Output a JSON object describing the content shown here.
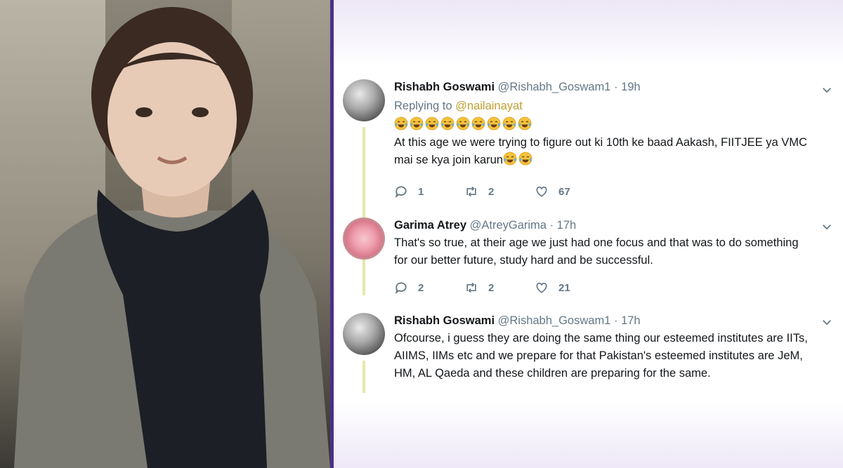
{
  "tweets": [
    {
      "name": "Rishabh Goswami",
      "handle": "@Rishabh_Goswam1",
      "separator": "·",
      "time": "19h",
      "replying_label": "Replying to",
      "replying_to": "@nailainayat",
      "emoji_line_count": 9,
      "text_line_1": "At this age we were trying to figure out ki 10th ke baad Aakash, FIITJEE ya VMC",
      "text_line_2": "mai se kya join karun",
      "text_line_2_emoji_count": 2,
      "replies": "1",
      "retweets": "2",
      "likes": "67"
    },
    {
      "name": "Garima Atrey",
      "handle": "@AtreyGarima",
      "separator": "·",
      "time": "17h",
      "text_line_1": "That's so true, at their age we just had one focus and that was to do something",
      "text_line_2": "for our better future, study hard and be successful.",
      "replies": "2",
      "retweets": "2",
      "likes": "21"
    },
    {
      "name": "Rishabh Goswami",
      "handle": "@Rishabh_Goswam1",
      "separator": "·",
      "time": "17h",
      "text_line_1": "Ofcourse, i guess they are doing the same thing our esteemed institutes are IITs,",
      "text_line_2": "AIIMS, IIMs etc and we prepare for that Pakistan's esteemed institutes are JeM,",
      "text_line_3": "HM, AL Qaeda and these children are preparing for the same."
    }
  ],
  "icons": {
    "reply": "reply-icon",
    "retweet": "retweet-icon",
    "like": "heart-icon",
    "more": "chevron-down-icon",
    "emoji": "face-with-tears-of-joy-icon"
  },
  "colors": {
    "divider": "#4b2f8a",
    "mention": "#c0a033",
    "thread_line": "#e6e7a9",
    "secondary_text": "#657786"
  }
}
